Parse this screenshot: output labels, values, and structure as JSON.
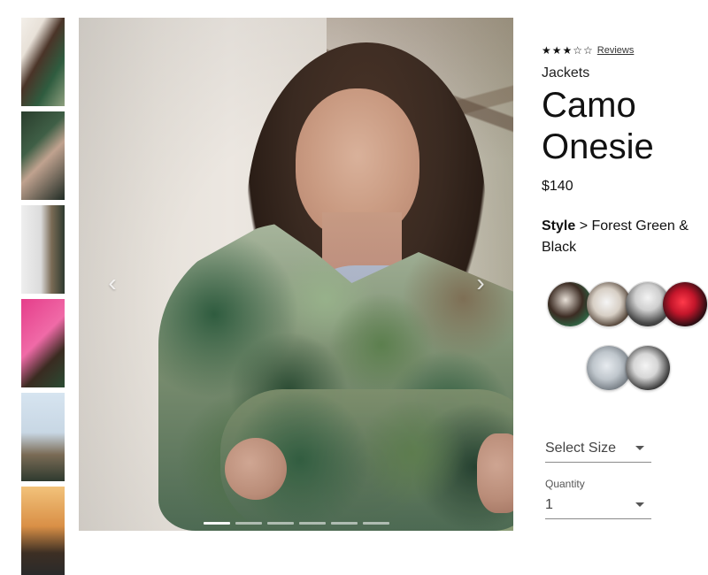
{
  "product": {
    "rating": {
      "stars": "★★★☆☆",
      "reviews_link": "Reviews"
    },
    "category": "Jackets",
    "title_line1": "Camo",
    "title_line2": "Onesie",
    "price": "$140",
    "style_label": "Style",
    "style_separator": ">",
    "style_value": "Forest Green & Black"
  },
  "carousel": {
    "prev_arrow": "‹",
    "next_arrow": "›",
    "indicators_count": 6,
    "active_index": 0
  },
  "controls": {
    "size_select_value": "Select Size",
    "quantity_label": "Quantity",
    "quantity_value": "1"
  },
  "thumbnails": [
    {
      "name": "woman-camo-front"
    },
    {
      "name": "person-sitting-camo"
    },
    {
      "name": "building-and-camo"
    },
    {
      "name": "pink-wall-camo"
    },
    {
      "name": "railway-camo"
    },
    {
      "name": "sunset-camo"
    }
  ],
  "swatches": [
    {
      "name": "swatch-camo-woman"
    },
    {
      "name": "swatch-white-jacket"
    },
    {
      "name": "swatch-city-street"
    },
    {
      "name": "swatch-red-dark"
    },
    {
      "name": "swatch-gray-sky"
    },
    {
      "name": "swatch-man-portrait"
    }
  ]
}
